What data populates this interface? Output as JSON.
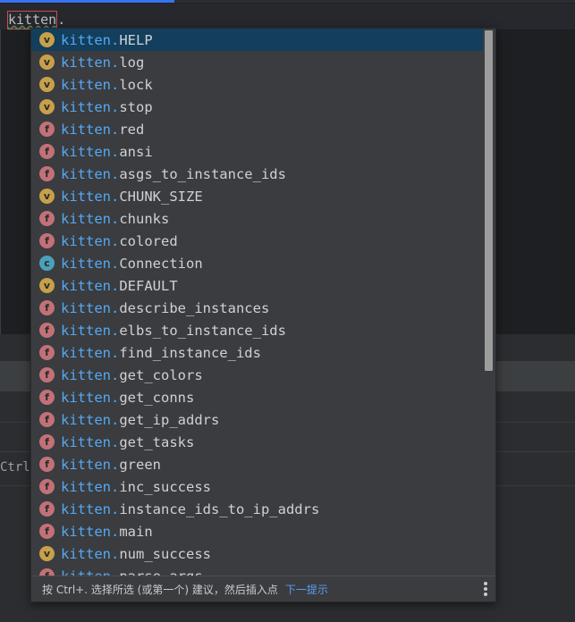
{
  "editor": {
    "typed_identifier": "kitten",
    "typed_suffix": "."
  },
  "panel": {
    "hint_fragment": "Ctrl"
  },
  "completion": {
    "module_prefix": "kitten.",
    "items": [
      {
        "kind": "v",
        "name": "HELP",
        "selected": true
      },
      {
        "kind": "v",
        "name": "log"
      },
      {
        "kind": "v",
        "name": "lock"
      },
      {
        "kind": "v",
        "name": "stop"
      },
      {
        "kind": "f",
        "name": "red"
      },
      {
        "kind": "f",
        "name": "ansi"
      },
      {
        "kind": "f",
        "name": "asgs_to_instance_ids"
      },
      {
        "kind": "v",
        "name": "CHUNK_SIZE"
      },
      {
        "kind": "f",
        "name": "chunks"
      },
      {
        "kind": "f",
        "name": "colored"
      },
      {
        "kind": "c",
        "name": "Connection"
      },
      {
        "kind": "v",
        "name": "DEFAULT"
      },
      {
        "kind": "f",
        "name": "describe_instances"
      },
      {
        "kind": "f",
        "name": "elbs_to_instance_ids"
      },
      {
        "kind": "f",
        "name": "find_instance_ids"
      },
      {
        "kind": "f",
        "name": "get_colors"
      },
      {
        "kind": "f",
        "name": "get_conns"
      },
      {
        "kind": "f",
        "name": "get_ip_addrs"
      },
      {
        "kind": "f",
        "name": "get_tasks"
      },
      {
        "kind": "f",
        "name": "green"
      },
      {
        "kind": "f",
        "name": "inc_success"
      },
      {
        "kind": "f",
        "name": "instance_ids_to_ip_addrs"
      },
      {
        "kind": "f",
        "name": "main"
      },
      {
        "kind": "v",
        "name": "num_success"
      },
      {
        "kind": "f",
        "name": "parse_args"
      }
    ],
    "footer": {
      "text": "按 Ctrl+. 选择所选 (或第一个) 建议，然后插入点",
      "link": "下一提示"
    }
  },
  "colors": {
    "accent": "#3574f0",
    "selection": "#133e5c",
    "prefix": "#56a8f5",
    "badge_v": "#c7a04a",
    "badge_f": "#c27178",
    "badge_c": "#4aa1b9"
  }
}
